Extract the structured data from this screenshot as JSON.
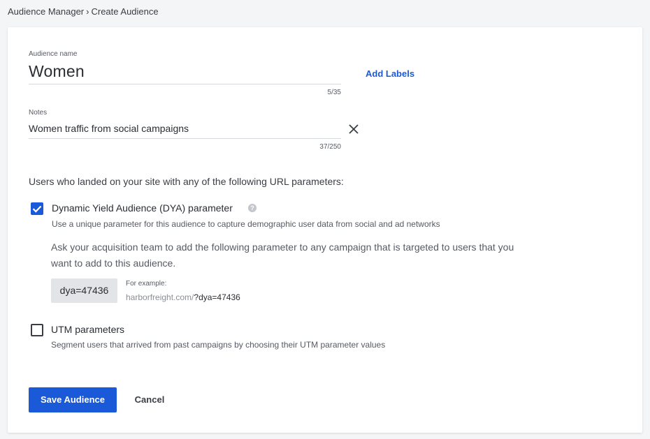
{
  "breadcrumb": {
    "parent": "Audience Manager",
    "separator": "›",
    "current": "Create Audience"
  },
  "form": {
    "name": {
      "label": "Audience name",
      "value": "Women",
      "counter": "5/35"
    },
    "add_labels": "Add Labels",
    "notes": {
      "label": "Notes",
      "value": "Women traffic from social campaigns",
      "counter": "37/250"
    },
    "section_title": "Users who landed on your site with any of the following URL parameters:",
    "dya": {
      "checked": true,
      "title": "Dynamic Yield Audience (DYA) parameter",
      "help_icon": "?",
      "description": "Use a unique parameter for this audience to capture demographic user data from social and ad networks",
      "instruction": "Ask your acquisition team to add the following parameter to any campaign that is targeted to users that you want to add to this audience.",
      "parameter": "dya=47436",
      "example_label": "For example:",
      "example_domain": "harborfreight.com/",
      "example_param": "?dya=47436"
    },
    "utm": {
      "checked": false,
      "title": "UTM parameters",
      "description": "Segment users that arrived from past campaigns by choosing their UTM parameter values"
    }
  },
  "actions": {
    "save": "Save Audience",
    "cancel": "Cancel"
  },
  "colors": {
    "accent": "#1a5ad8",
    "background": "#f4f5f7",
    "card": "#ffffff"
  }
}
